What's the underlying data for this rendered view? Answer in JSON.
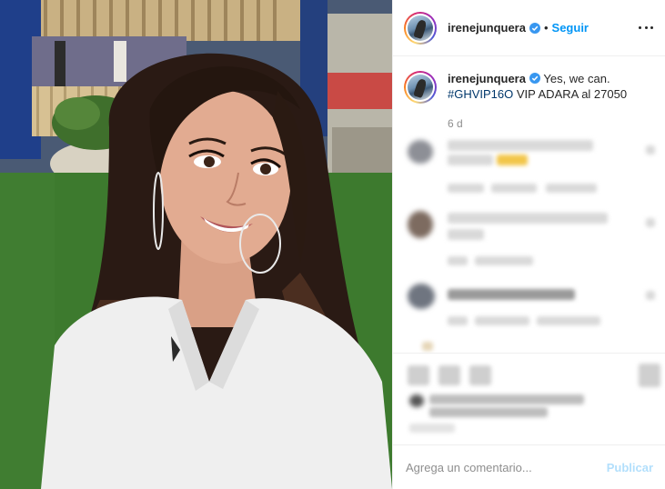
{
  "post": {
    "username": "irenejunquera",
    "follow_label": "Seguir",
    "separator": "•",
    "caption_text": "Yes, we can.",
    "caption_hashtag": "#GHVIP16O",
    "caption_rest": "VIP ADARA al 27050",
    "age": "6 d"
  },
  "comment_box": {
    "placeholder": "Agrega un comentario...",
    "publish_label": "Publicar"
  },
  "colors": {
    "link": "#0095f6",
    "hashtag": "#00376b",
    "publish_disabled": "#b2dffc",
    "verified": "#3897f0"
  },
  "icons": [
    "verified-badge-icon",
    "more-options-icon",
    "like-icon",
    "comment-icon",
    "share-icon",
    "save-icon"
  ]
}
